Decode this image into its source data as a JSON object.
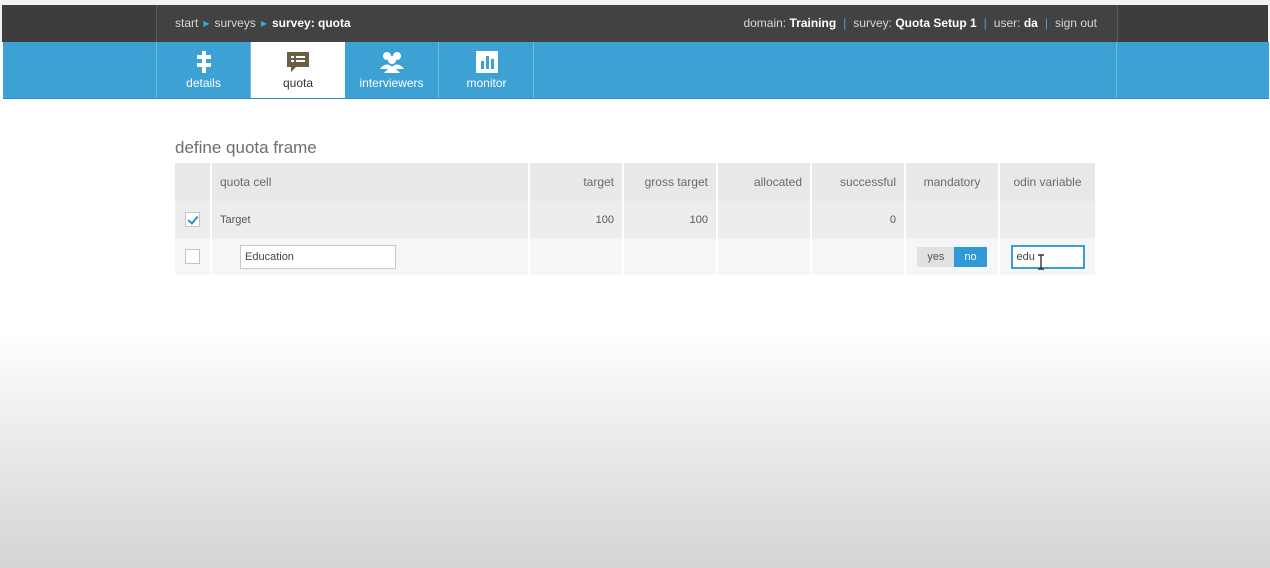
{
  "breadcrumb": {
    "items": [
      "start",
      "surveys"
    ],
    "current": "survey: quota"
  },
  "header": {
    "domain_label": "domain:",
    "domain_value": "Training",
    "survey_label": "survey:",
    "survey_value": "Quota Setup 1",
    "user_label": "user:",
    "user_value": "da",
    "sign_out": "sign out"
  },
  "tabs": [
    {
      "label": "details",
      "icon": "details-icon"
    },
    {
      "label": "quota",
      "icon": "quota-icon",
      "active": true
    },
    {
      "label": "interviewers",
      "icon": "interviewers-icon"
    },
    {
      "label": "monitor",
      "icon": "monitor-icon"
    }
  ],
  "section_title": "define quota frame",
  "table": {
    "columns": [
      "quota cell",
      "target",
      "gross target",
      "allocated",
      "successful",
      "mandatory",
      "odin variable"
    ],
    "rows": [
      {
        "checked": true,
        "cell": "Target",
        "target": "100",
        "gross_target": "100",
        "allocated": "",
        "successful": "0",
        "mandatory": "",
        "odin_variable": ""
      },
      {
        "checked": false,
        "cell_input": "Education",
        "mandatory_yes": "yes",
        "mandatory_no": "no",
        "mandatory_selected": "no",
        "odin_variable_input": "edu"
      }
    ]
  },
  "colors": {
    "accent": "#3da1d4",
    "topbar": "#424242",
    "selected_toggle": "#2f9ad6"
  }
}
